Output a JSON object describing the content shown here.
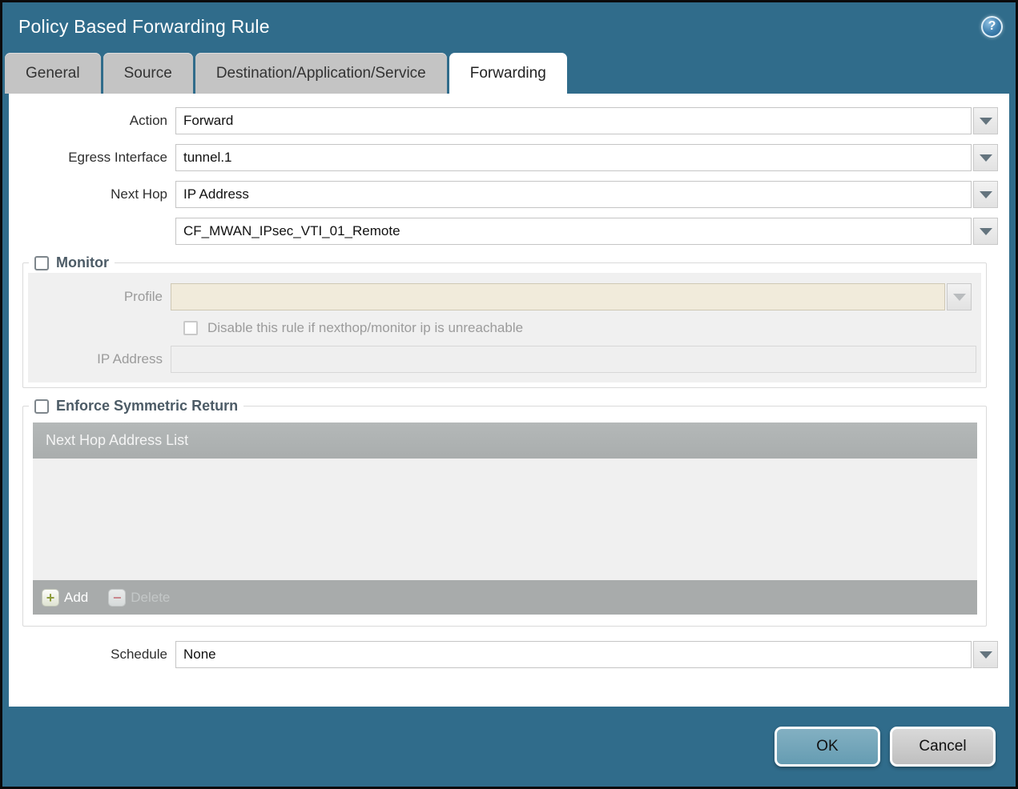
{
  "window": {
    "title": "Policy Based Forwarding Rule"
  },
  "icons": {
    "help": "?",
    "add": "+",
    "delete": "−"
  },
  "tabs": {
    "items": [
      {
        "label": "General"
      },
      {
        "label": "Source"
      },
      {
        "label": "Destination/Application/Service"
      },
      {
        "label": "Forwarding"
      }
    ],
    "active": "Forwarding"
  },
  "form": {
    "action": {
      "label": "Action",
      "value": "Forward"
    },
    "egress_interface": {
      "label": "Egress Interface",
      "value": "tunnel.1"
    },
    "next_hop": {
      "label": "Next Hop",
      "value": "IP Address"
    },
    "next_hop_address": {
      "value": "CF_MWAN_IPsec_VTI_01_Remote"
    },
    "schedule": {
      "label": "Schedule",
      "value": "None"
    }
  },
  "monitor": {
    "legend": "Monitor",
    "checked": false,
    "profile": {
      "label": "Profile",
      "value": ""
    },
    "disable_rule": {
      "label": "Disable this rule if nexthop/monitor ip is unreachable",
      "checked": false
    },
    "ip_address": {
      "label": "IP Address",
      "value": ""
    }
  },
  "symmetric_return": {
    "legend": "Enforce Symmetric Return",
    "checked": false,
    "table": {
      "header": "Next Hop Address List",
      "rows": []
    },
    "add_label": "Add",
    "delete_label": "Delete"
  },
  "footer": {
    "ok_label": "OK",
    "cancel_label": "Cancel"
  },
  "colors": {
    "frame_teal": "#306C8B",
    "tab_inactive": "#c4c4c4",
    "legend_text": "#4c5b66",
    "disabled_field_beige": "#f1ebdb",
    "table_header_gray": "#aeb2b2",
    "ok_button": "#6fa3b8",
    "cancel_button": "#c8c8c8",
    "add_plus_green": "#8e9c3c",
    "delete_minus_red": "#c9858c"
  }
}
